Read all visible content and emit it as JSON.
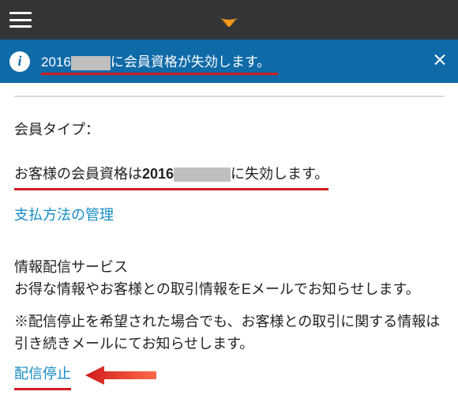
{
  "topbar": {
    "logo_name": "audible-logo"
  },
  "banner": {
    "prefix": "2016",
    "redacted": "XXXX",
    "suffix": "に会員資格が失効します。"
  },
  "content": {
    "member_type_label": "会員タイプ：",
    "expiry": {
      "prefix": "お客様の会員資格は",
      "year": "2016",
      "redacted": "XXXXXX",
      "suffix": "に失効します。"
    },
    "payment_link": "支払方法の管理",
    "info_service_title": "情報配信サービス",
    "info_service_body": "お得な情報やお客様との取引情報をEメールでお知らせします。",
    "note": "※配信停止を希望された場合でも、お客様との取引に関する情報は引き続きメールにてお知らせします。",
    "stop_link": "配信停止"
  }
}
